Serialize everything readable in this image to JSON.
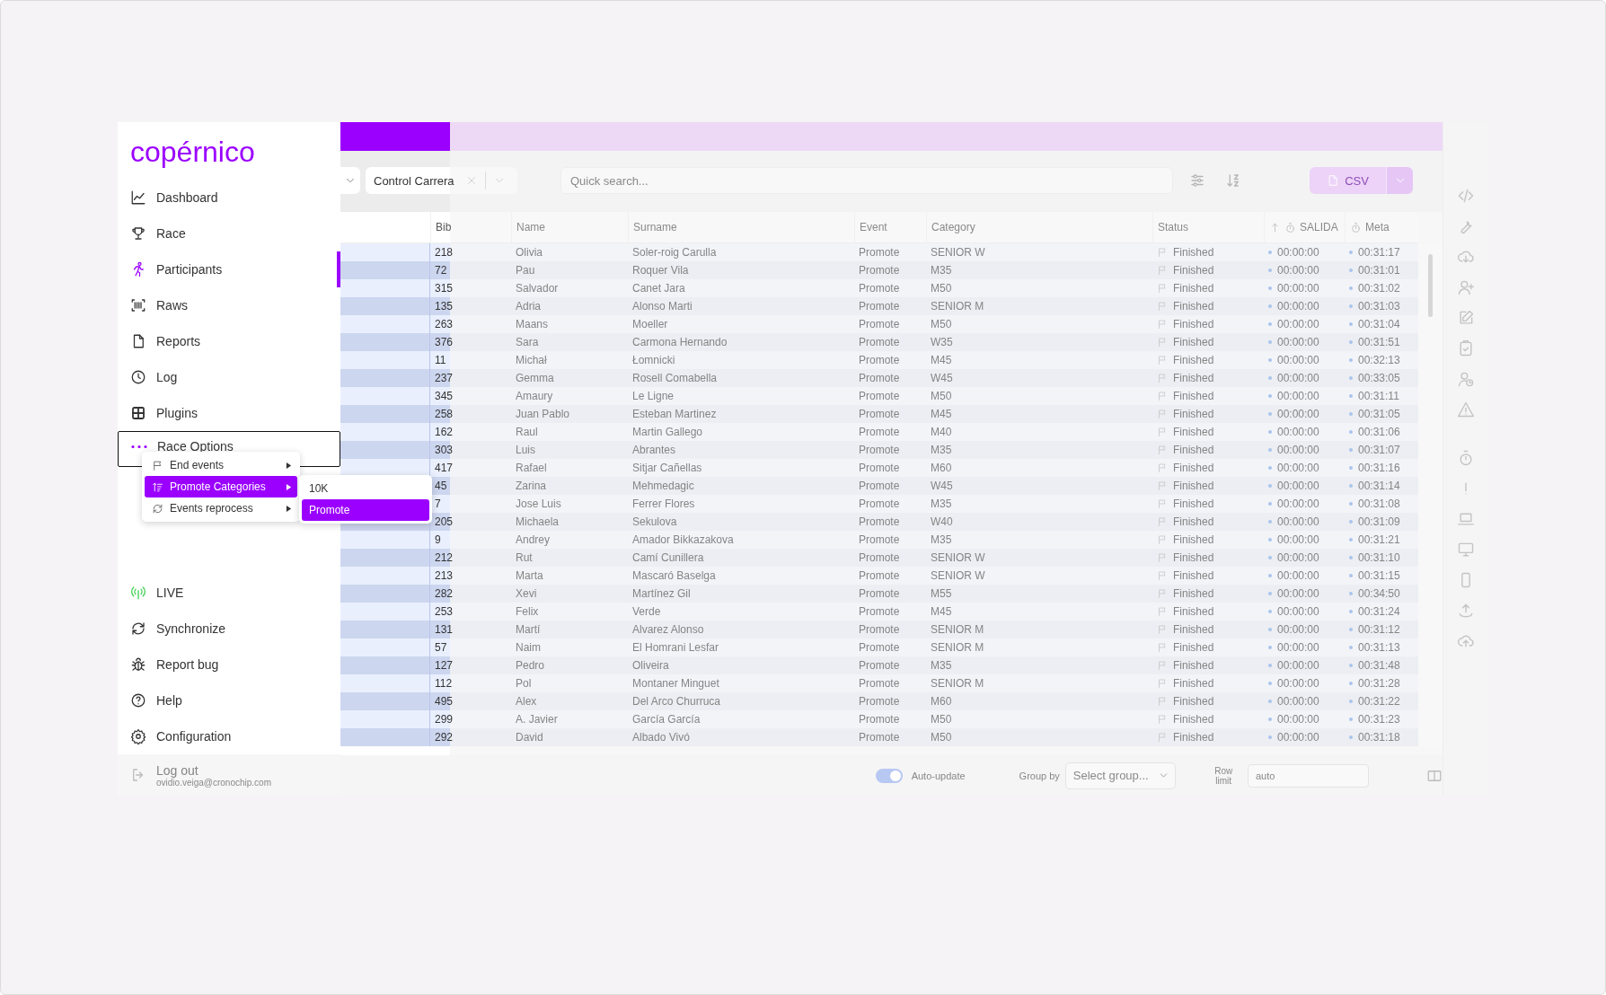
{
  "logo": "copérnico",
  "nav": [
    {
      "label": "Dashboard",
      "selected": false
    },
    {
      "label": "Race",
      "selected": false
    },
    {
      "label": "Participants",
      "selected": true
    },
    {
      "label": "Raws",
      "selected": false
    },
    {
      "label": "Reports",
      "selected": false
    },
    {
      "label": "Log",
      "selected": false
    },
    {
      "label": "Plugins",
      "selected": false
    }
  ],
  "race_options": {
    "label": "Race Options",
    "expanded": true
  },
  "nav_bottom": [
    {
      "label": "LIVE"
    },
    {
      "label": "Synchronize"
    },
    {
      "label": "Report bug"
    },
    {
      "label": "Help"
    },
    {
      "label": "Configuration"
    }
  ],
  "logout": {
    "label": "Log out",
    "email": "ovidio.veiga@cronochip.com"
  },
  "context_menu": {
    "items": [
      {
        "label": "End events",
        "selected": false
      },
      {
        "label": "Promote Categories",
        "selected": true
      },
      {
        "label": "Events reprocess",
        "selected": false
      }
    ]
  },
  "submenu": {
    "items": [
      {
        "label": "10K",
        "selected": false
      },
      {
        "label": "Promote",
        "selected": true
      }
    ]
  },
  "toolbar": {
    "event_filter": "Control Carrera",
    "search_placeholder": "Quick search...",
    "export_label": "CSV"
  },
  "table": {
    "columns": [
      {
        "label": "Bib",
        "kind": "text"
      },
      {
        "label": "Name",
        "kind": "text"
      },
      {
        "label": "Surname",
        "kind": "text"
      },
      {
        "label": "Event",
        "kind": "text"
      },
      {
        "label": "Category",
        "kind": "text"
      },
      {
        "label": "Status",
        "kind": "status"
      },
      {
        "label": "SALIDA",
        "kind": "time",
        "sorted": true
      },
      {
        "label": "Meta",
        "kind": "time"
      }
    ],
    "rows": [
      [
        "218",
        "Olivia",
        "Soler-roig Carulla",
        "Promote",
        "SENIOR W",
        "Finished",
        "00:00:00",
        "00:31:17"
      ],
      [
        "72",
        "Pau",
        "Roquer Vila",
        "Promote",
        "M35",
        "Finished",
        "00:00:00",
        "00:31:01"
      ],
      [
        "315",
        "Salvador",
        "Canet Jara",
        "Promote",
        "M50",
        "Finished",
        "00:00:00",
        "00:31:02"
      ],
      [
        "135",
        "Adria",
        "Alonso Marti",
        "Promote",
        "SENIOR M",
        "Finished",
        "00:00:00",
        "00:31:03"
      ],
      [
        "263",
        "Maans",
        "Moeller",
        "Promote",
        "M50",
        "Finished",
        "00:00:00",
        "00:31:04"
      ],
      [
        "376",
        "Sara",
        "Carmona Hernando",
        "Promote",
        "W35",
        "Finished",
        "00:00:00",
        "00:31:51"
      ],
      [
        "11",
        "Michał",
        "Łomnicki",
        "Promote",
        "M45",
        "Finished",
        "00:00:00",
        "00:32:13"
      ],
      [
        "237",
        "Gemma",
        "Rosell Comabella",
        "Promote",
        "W45",
        "Finished",
        "00:00:00",
        "00:33:05"
      ],
      [
        "345",
        "Amaury",
        "Le Ligne",
        "Promote",
        "M50",
        "Finished",
        "00:00:00",
        "00:31:11"
      ],
      [
        "258",
        "Juan Pablo",
        "Esteban Martinez",
        "Promote",
        "M45",
        "Finished",
        "00:00:00",
        "00:31:05"
      ],
      [
        "162",
        "Raul",
        "Martin Gallego",
        "Promote",
        "M40",
        "Finished",
        "00:00:00",
        "00:31:06"
      ],
      [
        "303",
        "Luis",
        "Abrantes",
        "Promote",
        "M35",
        "Finished",
        "00:00:00",
        "00:31:07"
      ],
      [
        "417",
        "Rafael",
        "Sitjar Cañellas",
        "Promote",
        "M60",
        "Finished",
        "00:00:00",
        "00:31:16"
      ],
      [
        "45",
        "Zarina",
        "Mehmedagic",
        "Promote",
        "W45",
        "Finished",
        "00:00:00",
        "00:31:14"
      ],
      [
        "7",
        "Jose Luis",
        "Ferrer Flores",
        "Promote",
        "M35",
        "Finished",
        "00:00:00",
        "00:31:08"
      ],
      [
        "205",
        "Michaela",
        "Sekulova",
        "Promote",
        "W40",
        "Finished",
        "00:00:00",
        "00:31:09"
      ],
      [
        "9",
        "Andrey",
        "Amador Bikkazakova",
        "Promote",
        "M35",
        "Finished",
        "00:00:00",
        "00:31:21"
      ],
      [
        "212",
        "Rut",
        "Camí Cunillera",
        "Promote",
        "SENIOR W",
        "Finished",
        "00:00:00",
        "00:31:10"
      ],
      [
        "213",
        "Marta",
        "Mascaró Baselga",
        "Promote",
        "SENIOR W",
        "Finished",
        "00:00:00",
        "00:31:15"
      ],
      [
        "282",
        "Xevi",
        "Martínez Gil",
        "Promote",
        "M55",
        "Finished",
        "00:00:00",
        "00:34:50"
      ],
      [
        "253",
        "Felix",
        "Verde",
        "Promote",
        "M45",
        "Finished",
        "00:00:00",
        "00:31:24"
      ],
      [
        "131",
        "Martí",
        "Alvarez Alonso",
        "Promote",
        "SENIOR M",
        "Finished",
        "00:00:00",
        "00:31:12"
      ],
      [
        "57",
        "Naim",
        "El Homrani Lesfar",
        "Promote",
        "SENIOR M",
        "Finished",
        "00:00:00",
        "00:31:13"
      ],
      [
        "127",
        "Pedro",
        "Oliveira",
        "Promote",
        "M35",
        "Finished",
        "00:00:00",
        "00:31:48"
      ],
      [
        "112",
        "Pol",
        "Montaner Minguet",
        "Promote",
        "SENIOR M",
        "Finished",
        "00:00:00",
        "00:31:28"
      ],
      [
        "495",
        "Alex",
        "Del Arco Churruca",
        "Promote",
        "M60",
        "Finished",
        "00:00:00",
        "00:31:22"
      ],
      [
        "299",
        "A. Javier",
        "García García",
        "Promote",
        "M50",
        "Finished",
        "00:00:00",
        "00:31:23"
      ],
      [
        "292",
        "David",
        "Albado Vivó",
        "Promote",
        "M50",
        "Finished",
        "00:00:00",
        "00:31:18"
      ]
    ]
  },
  "footer": {
    "auto_update": {
      "label": "Auto-update",
      "on": true
    },
    "group_by": {
      "label": "Group by",
      "placeholder": "Select group..."
    },
    "row_limit": {
      "label": "Row limit",
      "value": "auto"
    }
  }
}
